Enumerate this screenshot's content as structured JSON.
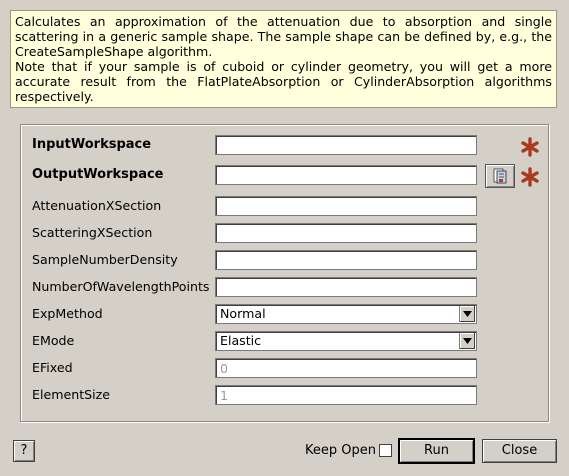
{
  "description": {
    "line1": "Calculates an approximation of the attenuation due to absorption and single scattering in a generic sample shape. The sample shape can be defined by, e.g., the CreateSampleShape algorithm.",
    "line2": "Note that if your sample is of cuboid or cylinder geometry, you will get a more accurate result from the FlatPlateAbsorption or CylinderAbsorption algorithms respectively."
  },
  "properties": [
    {
      "label": "InputWorkspace",
      "value": "",
      "mandatory": true
    },
    {
      "label": "OutputWorkspace",
      "value": "",
      "mandatory": true
    },
    {
      "label": "AttenuationXSection",
      "value": ""
    },
    {
      "label": "ScatteringXSection",
      "value": ""
    },
    {
      "label": "SampleNumberDensity",
      "value": ""
    },
    {
      "label": "NumberOfWavelengthPoints",
      "value": ""
    },
    {
      "label": "ExpMethod",
      "value": "Normal"
    },
    {
      "label": "EMode",
      "value": "Elastic"
    },
    {
      "label": "EFixed",
      "value": "0"
    },
    {
      "label": "ElementSize",
      "value": "1"
    }
  ],
  "icons": {
    "mandatory": "asterisk-icon",
    "browse": "browse-file-icon",
    "dropdown": "chevron-down-icon"
  },
  "colors": {
    "mandatory_star": "#a83a22",
    "description_bg": "#ffffdc"
  },
  "footer": {
    "help_label": "?",
    "keep_open_label": "Keep Open",
    "keep_open_checked": false,
    "run_label": "Run",
    "close_label": "Close"
  }
}
